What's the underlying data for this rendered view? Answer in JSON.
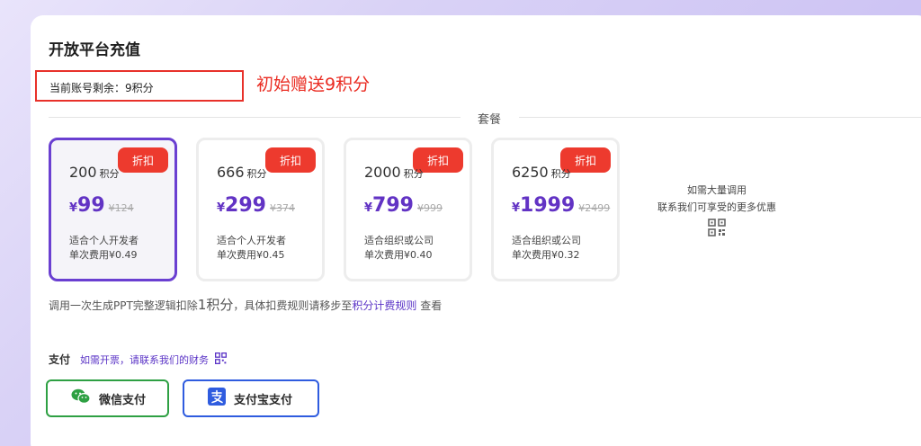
{
  "page": {
    "title": "开放平台充值",
    "remain_label": "当前账号剩余：9积分",
    "gift_note": "初始赠送9积分",
    "section_label": "套餐"
  },
  "plans": [
    {
      "credits": "200",
      "unit": "积分",
      "badge": "折扣",
      "currency": "¥",
      "price": "99",
      "original": "¥124",
      "desc1": "适合个人开发者",
      "desc2": "单次费用¥0.49",
      "selected": true
    },
    {
      "credits": "666",
      "unit": "积分",
      "badge": "折扣",
      "currency": "¥",
      "price": "299",
      "original": "¥374",
      "desc1": "适合个人开发者",
      "desc2": "单次费用¥0.45",
      "selected": false
    },
    {
      "credits": "2000",
      "unit": "积分",
      "badge": "折扣",
      "currency": "¥",
      "price": "799",
      "original": "¥999",
      "desc1": "适合组织或公司",
      "desc2": "单次费用¥0.40",
      "selected": false
    },
    {
      "credits": "6250",
      "unit": "积分",
      "badge": "折扣",
      "currency": "¥",
      "price": "1999",
      "original": "¥2499",
      "desc1": "适合组织或公司",
      "desc2": "单次费用¥0.32",
      "selected": false
    }
  ],
  "bulk": {
    "line1": "如需大量调用",
    "line2": "联系我们可享受的更多优惠",
    "icon": "qr-code-icon"
  },
  "rule": {
    "prefix": "调用一次生成PPT完整逻辑扣除",
    "amount": "1积分",
    "middle": "，具体扣费规则请移步至",
    "link": "积分计费规则",
    "suffix": " 查看"
  },
  "payment": {
    "label": "支付",
    "invoice_note": "如需开票，请联系我们的财务",
    "wechat_label": "微信支付",
    "alipay_label": "支付宝支付"
  },
  "colors": {
    "accent": "#6233c4",
    "badge": "#ed3a2e",
    "highlight_box": "#e8312a",
    "wechat": "#2ea043",
    "alipay": "#2f5cdf"
  }
}
